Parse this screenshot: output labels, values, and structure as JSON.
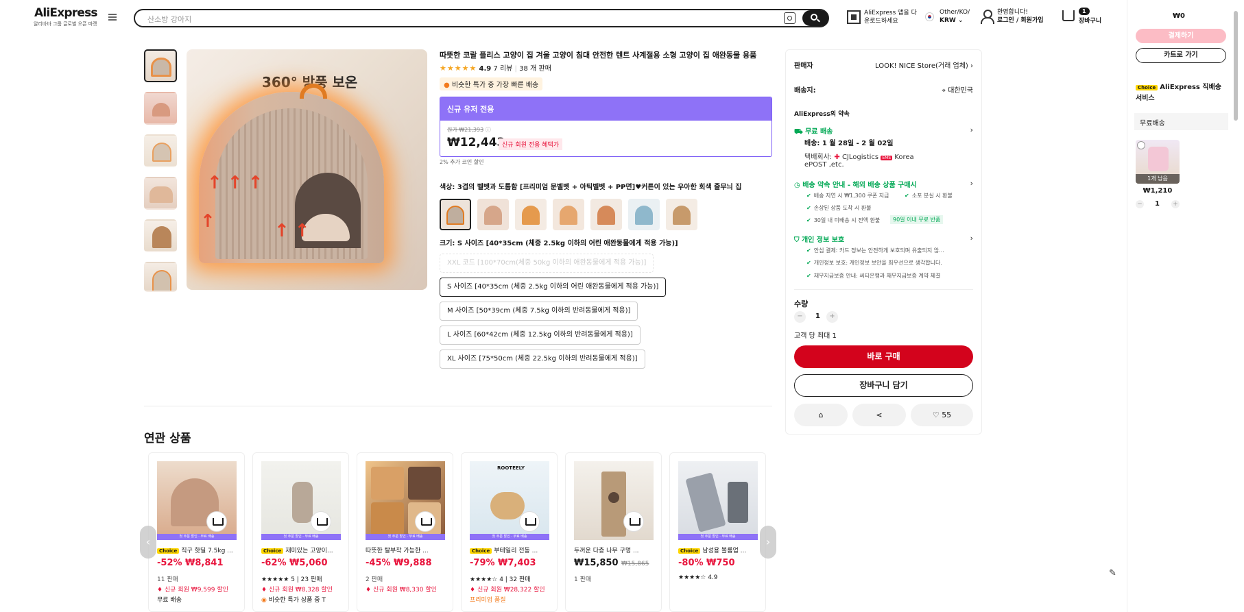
{
  "header": {
    "logo": "AliExpress",
    "logo_sub": "알리바바 그룹 글로벌 오픈 마켓",
    "search_placeholder": "산소방 강아지",
    "app_line1": "AliExpress 앱을 다",
    "app_line2": "운로드하세요",
    "region_line1": "Other/KO/",
    "region_line2": "KRW",
    "welcome": "환영합니다!",
    "login": "로그인 / 회원가입",
    "cart_count": "1",
    "cart_label": "장바구니"
  },
  "product": {
    "title": "따뜻한 코랄 플리스 고양이 집 겨울 고양이 침대 안전한 텐트 사계절용 소형 고양이 집 애완동물 용품",
    "stars": "★★★★★",
    "rating": "4.9",
    "reviews": "7 리뷰",
    "sold": "38 개 판매",
    "fast_badge": "비슷한 특가 중 가장 빠른 배송",
    "main_image_text": "360° 방풍 보온",
    "promo_header": "신규 유저 전용",
    "original_price": "원가 ₩21,393",
    "price": "₩12,443",
    "new_member_badge": "신규 회원 전용 혜택가",
    "coin_discount": "2% 추가 코인 할인",
    "color_label": "색상: 3겹의 벨벳과 도톰함 [프리미엄 문벨벳 + 아틱벨벳 + PP면]♥커튼이 있는 우아한 회색 줄무늬 집",
    "size_label": "크기: S 사이즈 [40*35cm (체중 2.5kg 이하의 어린 애완동물에게 적용 가능)]",
    "sizes": [
      "XXL 코드 [100*70cm(체중 50kg 이하의 애완동물에게 적용 가능)]",
      "S 사이즈 [40*35cm (체중 2.5kg 이하의 어린 애완동물에게 적용 가능)]",
      "M 사이즈 [50*39cm (체중 7.5kg 이하의 반려동물에게 적용)]",
      "L 사이즈 [60*42cm (체중 12.5kg 이하의 반려동물에게 적용)]",
      "XL 사이즈 [75*50cm (체중 22.5kg 이하의 반려동물에게 적용)]"
    ]
  },
  "panel": {
    "seller_label": "판매자",
    "seller_name": "LOOK! NICE Store(거래 업체)",
    "ship_to_label": "배송지:",
    "ship_to": "대한민국",
    "promise_title": "AliExpress의 약속",
    "free_ship": "무료 배송",
    "delivery": "배송: 1 월 28일 - 2 월 02일",
    "courier_label": "택배회사:",
    "courier": "CJLogistics",
    "courier_country": "Korea",
    "courier_more": "ePOST ,etc.",
    "promise_guide": "배송 약속 안내 - 해외 배송 상품 구매시",
    "promise_items": [
      "배송 지연 시 ₩1,300 쿠폰 지급",
      "소포 분실 시 환불",
      "손상된 상품 도착 시 환불",
      "30일 내 미배송 시 전액 환불"
    ],
    "return_badge": "90일 이내 무료 반품",
    "privacy_title": "개인 정보 보호",
    "privacy_items": [
      "안심 결제: 카드 정보는 안전하게 보호되며 유출되지 않...",
      "개인정보 보호: 개인정보 보안을 최우선으로 생각합니다.",
      "채무지급보증 안내: 씨티은행과 채무지급보증 계약 체결"
    ],
    "qty_label": "수량",
    "qty_value": "1",
    "qty_minus": "−",
    "qty_plus": "+",
    "limit": "고객 당 최대 1",
    "buy_now": "바로 구매",
    "add_to_cart": "장바구니 담기",
    "likes": "55"
  },
  "related": {
    "title": "연관 상품",
    "cards": [
      {
        "choice": "Choice",
        "name": "직구 핫딜 7.5kg ...",
        "price": "-52% ₩8,841",
        "line1": "11 판매",
        "line2": "신규 회원 ₩9,599 할인",
        "line3": "무료 배송",
        "strip": "첫 주문 할인 · 무료 배송"
      },
      {
        "choice": "Choice",
        "name": "재미있는 고양이...",
        "price": "-62% ₩5,060",
        "line1": "★★★★★ 5 | 23 판매",
        "line2": "신규 회원 ₩8,328 할인",
        "line3": "비슷한 특가 상품 중 T",
        "strip": "첫 주문 할인 · 무료 배송"
      },
      {
        "choice": "",
        "name": "따뜻한 탈부착 가능한 ...",
        "price": "-45% ₩9,888",
        "line1": "2 판매",
        "line2": "신규 회원 ₩8,330 할인",
        "line3": "",
        "strip": "첫 주문 할인 · 무료 배송"
      },
      {
        "choice": "Choice",
        "name": "부테일리 전동 ...",
        "price": "-79% ₩7,403",
        "line1": "★★★★☆ 4 | 32 판매",
        "line2": "신규 회원 ₩28,322 할인",
        "line3": "프리미엄 품질",
        "strip": "첫 주문 할인 · 무료 배송"
      },
      {
        "choice": "",
        "name": "두꺼운 다층 나무 구멍 ...",
        "price": "₩15,850",
        "orig": "₩15,865",
        "line1": "1 판매",
        "line2": "",
        "line3": "",
        "strip": ""
      },
      {
        "choice": "Choice",
        "name": "남성용 볼룸업 ...",
        "price": "-80% ₩750",
        "line1": "★★★★☆ 4.9",
        "line2": "",
        "line3": "",
        "strip": "첫 주문 할인 · 무료 배송"
      }
    ]
  },
  "minicart": {
    "total": "₩0",
    "pay": "결제하기",
    "go_cart": "카트로 가기",
    "service_badge": "Choice",
    "service": "AliExpress 직배송 서비스",
    "free": "무료배송",
    "item_left": "1개 남음",
    "item_price": "₩1,210",
    "item_qty": "1"
  },
  "colors": {
    "accent": "#d3031c",
    "promo": "#8e72f7",
    "green": "#00a854"
  }
}
